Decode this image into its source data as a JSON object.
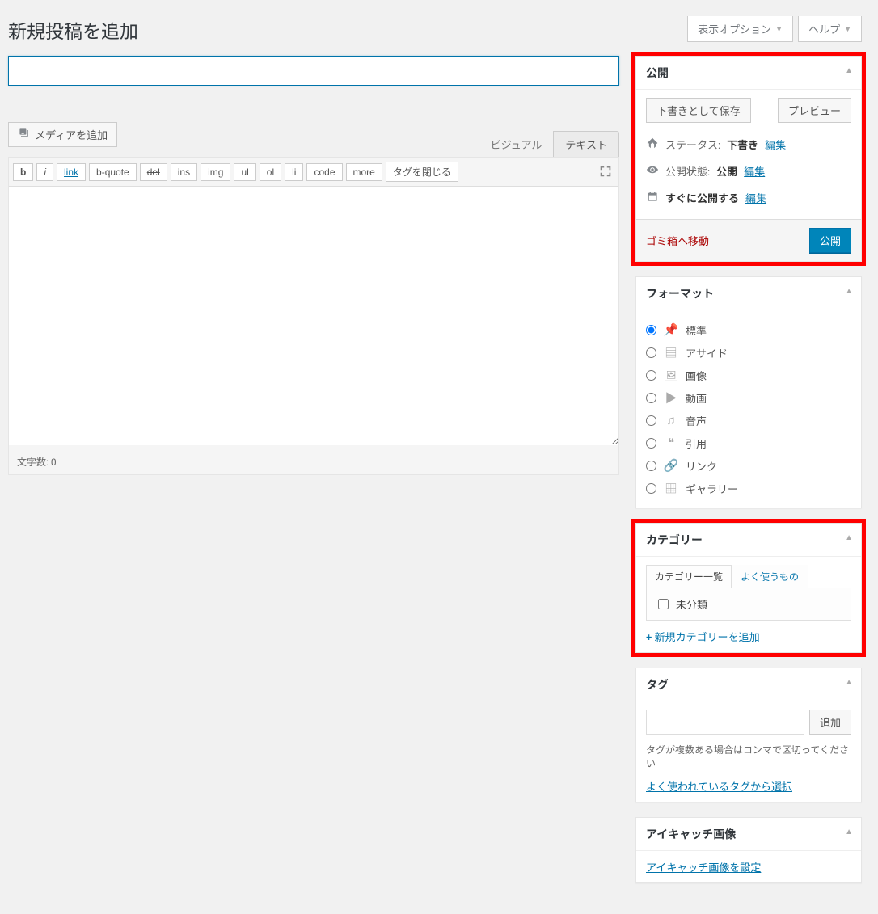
{
  "top": {
    "screen_options": "表示オプション",
    "help": "ヘルプ"
  },
  "page_title": "新規投稿を追加",
  "title_placeholder": "",
  "media_button": "メディアを追加",
  "editor_tabs": {
    "visual": "ビジュアル",
    "text": "テキスト"
  },
  "quicktags": [
    "b",
    "i",
    "link",
    "b-quote",
    "del",
    "ins",
    "img",
    "ul",
    "ol",
    "li",
    "code",
    "more",
    "タグを閉じる"
  ],
  "word_count": "文字数: 0",
  "publish": {
    "title": "公開",
    "save_draft": "下書きとして保存",
    "preview": "プレビュー",
    "status_label": "ステータス:",
    "status_value": "下書き",
    "status_edit": "編集",
    "visibility_label": "公開状態:",
    "visibility_value": "公開",
    "visibility_edit": "編集",
    "schedule_label": "すぐに公開する",
    "schedule_edit": "編集",
    "trash": "ゴミ箱へ移動",
    "publish_btn": "公開"
  },
  "format": {
    "title": "フォーマット",
    "items": [
      {
        "label": "標準",
        "icon": "📌",
        "checked": true
      },
      {
        "label": "アサイド",
        "icon": "▤",
        "checked": false
      },
      {
        "label": "画像",
        "icon": "🖼",
        "checked": false
      },
      {
        "label": "動画",
        "icon": "▶",
        "checked": false
      },
      {
        "label": "音声",
        "icon": "♫",
        "checked": false
      },
      {
        "label": "引用",
        "icon": "❝",
        "checked": false
      },
      {
        "label": "リンク",
        "icon": "🔗",
        "checked": false
      },
      {
        "label": "ギャラリー",
        "icon": "▦",
        "checked": false
      }
    ]
  },
  "category": {
    "title": "カテゴリー",
    "tab_all": "カテゴリー一覧",
    "tab_popular": "よく使うもの",
    "item": "未分類",
    "add_new": "+ 新規カテゴリーを追加"
  },
  "tags": {
    "title": "タグ",
    "add_btn": "追加",
    "hint": "タグが複数ある場合はコンマで区切ってください",
    "popular_link": "よく使われているタグから選択"
  },
  "featured": {
    "title": "アイキャッチ画像",
    "set_link": "アイキャッチ画像を設定"
  }
}
